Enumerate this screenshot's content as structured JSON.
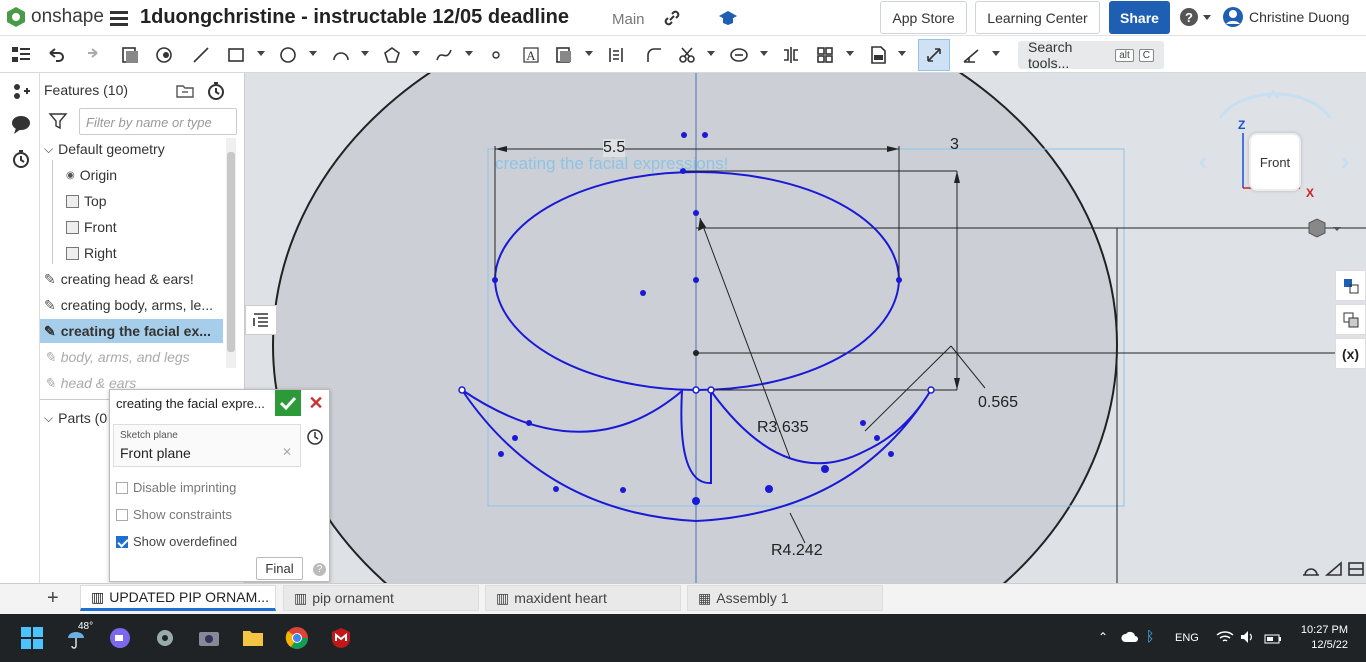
{
  "app": {
    "name": "onshape"
  },
  "header": {
    "document_title": "1duongchristine - instructable 12/05 deadline",
    "branch": "Main",
    "app_store": "App Store",
    "learning_center": "Learning Center",
    "share": "Share",
    "help": "?",
    "user_name": "Christine Duong"
  },
  "toolbar": {
    "search_placeholder": "Search tools...",
    "shortcut_1": "alt",
    "shortcut_2": "C"
  },
  "features": {
    "header": "Features (10)",
    "filter_placeholder": "Filter by name or type",
    "items": [
      {
        "label": "Default geometry"
      },
      {
        "label": "Origin"
      },
      {
        "label": "Top"
      },
      {
        "label": "Front"
      },
      {
        "label": "Right"
      },
      {
        "label": "creating head & ears!"
      },
      {
        "label": "creating body, arms, le..."
      },
      {
        "label": "creating the facial ex..."
      },
      {
        "label": "body, arms, and legs"
      },
      {
        "label": "head & ears"
      }
    ],
    "parts_label": "Parts (0"
  },
  "sketch_dialog": {
    "title": "creating the facial expre...",
    "plane_label": "Sketch plane",
    "plane_value": "Front plane",
    "disable_imprinting": "Disable imprinting",
    "show_constraints": "Show constraints",
    "show_overdefined": "Show overdefined",
    "show_overdefined_checked": true,
    "final": "Final"
  },
  "canvas": {
    "sketch_label": "creating the facial expressions!",
    "dim_width": "5.5",
    "dim_height": "3",
    "dim_offset": "0.565",
    "radius_1": "R3.635",
    "radius_2": "R4.242",
    "view_cube_face": "Front",
    "axis_z": "Z",
    "axis_x": "X"
  },
  "tabs": [
    {
      "label": "UPDATED PIP ORNAM..."
    },
    {
      "label": "pip ornament"
    },
    {
      "label": "maxident heart"
    },
    {
      "label": "Assembly 1"
    }
  ],
  "taskbar": {
    "temperature": "48°",
    "language": "ENG",
    "time": "10:27 PM",
    "date": "12/5/22"
  },
  "colors": {
    "sketch": "#1a1ad6",
    "accent": "#1f5fb3",
    "canvas": "#dee1e5",
    "selection": "#a6cde9"
  }
}
